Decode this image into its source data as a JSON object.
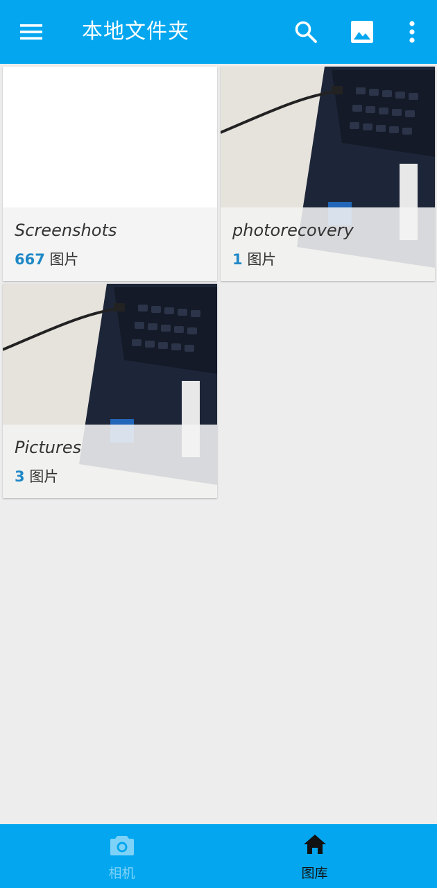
{
  "appbar": {
    "title": "本地文件夹",
    "icons": [
      "menu-icon",
      "search-icon",
      "image-icon",
      "more-vert-icon"
    ],
    "color": "#04a7ef"
  },
  "folders": [
    {
      "name": "Screenshots",
      "count": "667",
      "unit": "图片"
    },
    {
      "name": "photorecovery",
      "count": "1",
      "unit": "图片"
    },
    {
      "name": "Pictures",
      "count": "3",
      "unit": "图片"
    }
  ],
  "bottom_nav": {
    "camera_label": "相机",
    "gallery_label": "图库",
    "active": "gallery"
  },
  "colors": {
    "accent": "#04a7ef",
    "count": "#1e88c7",
    "background": "#ededed"
  }
}
